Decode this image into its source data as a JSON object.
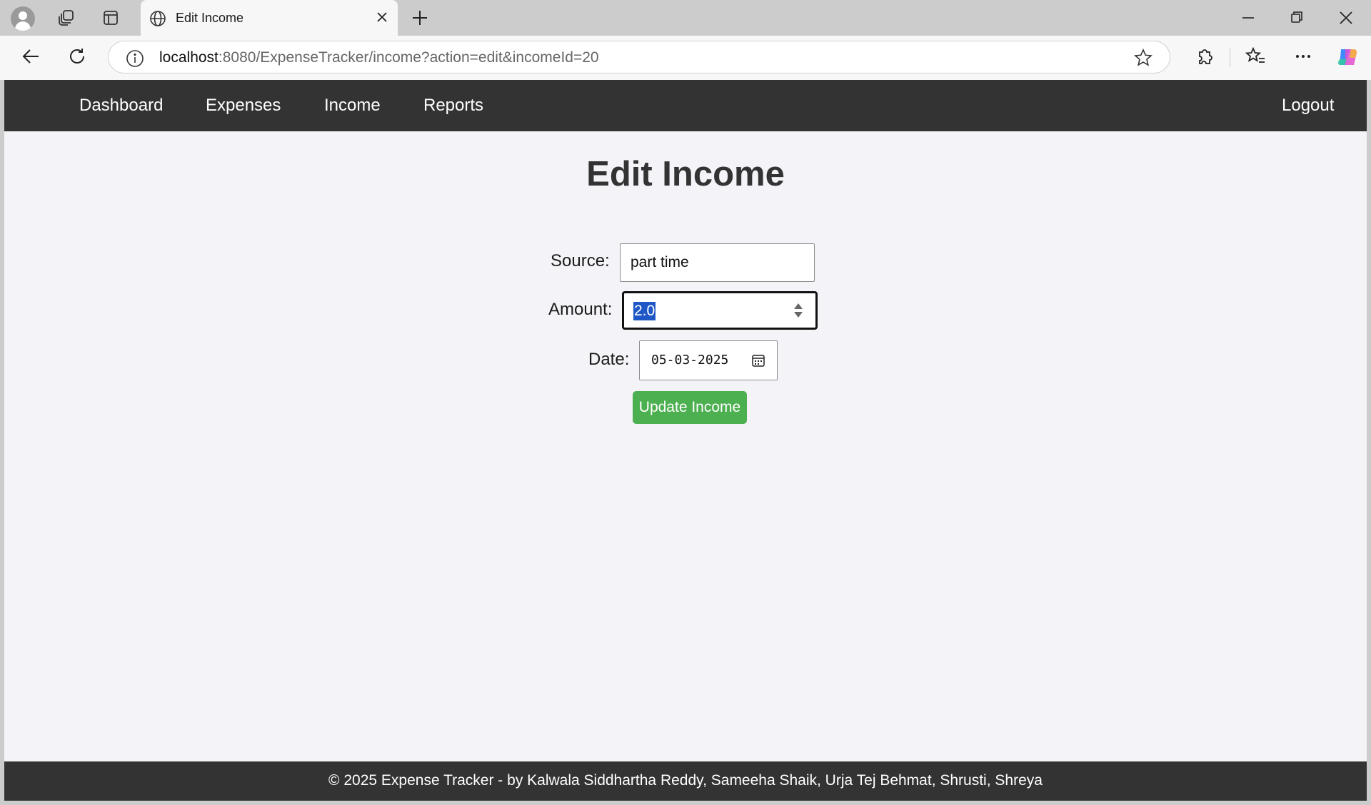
{
  "browser": {
    "tab_title": "Edit Income",
    "url_host": "localhost",
    "url_rest": ":8080/ExpenseTracker/income?action=edit&incomeId=20"
  },
  "nav": {
    "items": [
      {
        "label": "Dashboard"
      },
      {
        "label": "Expenses"
      },
      {
        "label": "Income"
      },
      {
        "label": "Reports"
      }
    ],
    "logout": "Logout"
  },
  "page": {
    "title": "Edit Income"
  },
  "form": {
    "source_label": "Source:",
    "source_value": "part time",
    "amount_label": "Amount:",
    "amount_value": "2.0",
    "date_label": "Date:",
    "date_value": "05-03-2025",
    "submit_label": "Update Income"
  },
  "footer": {
    "text": "© 2025 Expense Tracker - by Kalwala Siddhartha Reddy, Sameeha Shaik, Urja Tej Behmat, Shrusti, Shreya"
  },
  "icons": {
    "profile": "profile-icon",
    "workspaces": "workspaces-icon",
    "sidebar_toggle": "tab-actions-icon",
    "globe": "globe-icon",
    "close_tab": "close-icon",
    "new_tab": "plus-icon",
    "minimize": "minimize-icon",
    "restore": "restore-icon",
    "close_window": "close-icon",
    "back": "back-arrow-icon",
    "refresh": "refresh-icon",
    "site_info": "info-icon",
    "favorite": "star-icon",
    "extensions": "puzzle-icon",
    "favorites": "favorites-icon",
    "more": "ellipsis-icon",
    "copilot": "copilot-icon",
    "calendar": "calendar-icon",
    "spinner": "spinner-icon"
  },
  "colors": {
    "navbar": "#333333",
    "page_bg": "#f4f4f8",
    "button": "#4caf50",
    "selection": "#1f57c7"
  }
}
